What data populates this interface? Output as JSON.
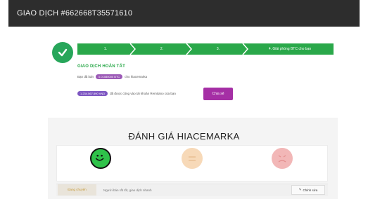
{
  "header": {
    "title": "GIAO DỊCH #662668T35571610"
  },
  "steps": [
    "1.",
    "2.",
    "3.",
    "4. Giải phóng BTC cho bạn"
  ],
  "status": {
    "title": "GIAO DỊCH HOÀN TẤT",
    "line1_prefix": "Bạn đã bán",
    "amount_pill": "0.01080000 BTC",
    "line1_suffix": "cho hiacemarka",
    "ref_pill": "1.234.567.890 VND",
    "line2_text": "đã được cộng vào tài khoản Remitano của bạn",
    "share_button": "Chia sẻ"
  },
  "rating": {
    "title": "ĐÁNH GIÁ HIACEMARKA",
    "faces": [
      "happy-face-icon",
      "neutral-face-icon",
      "sad-face-icon"
    ],
    "tab_label": "Đang chuyển",
    "comment_placeholder": "Người bán rất tốt, giao dịch nhanh",
    "edit_button": "Chỉnh sửa"
  },
  "colors": {
    "header_bg": "#2d2d2d",
    "success": "#2aa84a",
    "accent_purple": "#a52fa5",
    "pill_purple": "#9b59b6"
  }
}
